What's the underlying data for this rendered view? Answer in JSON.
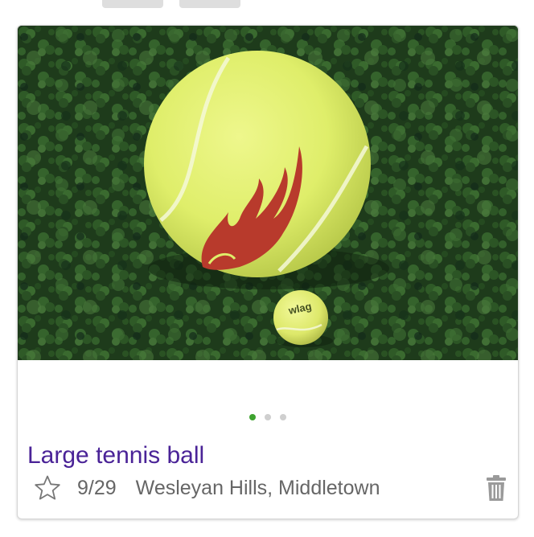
{
  "item": {
    "title": "Large tennis ball",
    "date": "9/29",
    "location": "Wesleyan Hills, Middletown",
    "image_alt": "Large tennis ball beside a small tennis ball on clover",
    "small_ball_text": "wlag"
  },
  "carousel": {
    "count": 3,
    "active_index": 0
  },
  "icons": {
    "favorite": "star-outline-icon",
    "delete": "trash-icon"
  },
  "colors": {
    "title": "#4a2397",
    "meta_text": "#666666",
    "active_dot": "#3ea32f",
    "inactive_dot": "#cfcfcf",
    "grass": "#1f3d1c",
    "ball": "#dfee6a"
  }
}
